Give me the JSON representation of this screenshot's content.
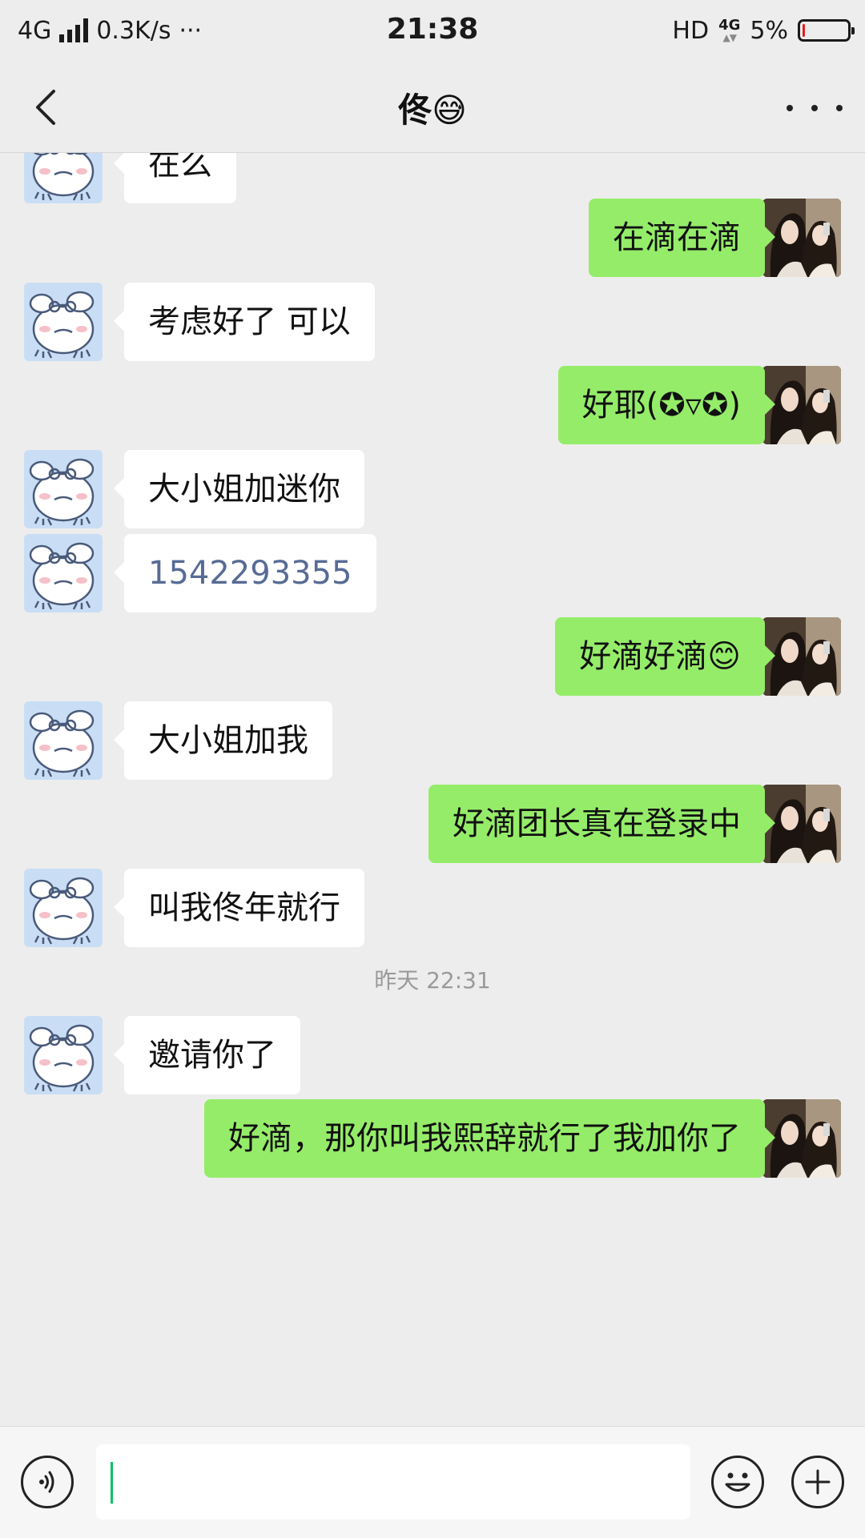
{
  "status_bar": {
    "network": "4G",
    "speed": "0.3K/s",
    "more": "···",
    "time": "21:38",
    "hd": "HD",
    "net_type": "4G",
    "battery_percent": "5%",
    "battery_level": 0.05
  },
  "nav": {
    "title": "佟😅"
  },
  "messages": [
    {
      "side": "in",
      "text": "在么"
    },
    {
      "side": "out",
      "text": "在滴在滴"
    },
    {
      "side": "in",
      "text": "考虑好了 可以"
    },
    {
      "side": "out",
      "text": "好耶(✪▿✪)"
    },
    {
      "side": "in",
      "text": "大小姐加迷你"
    },
    {
      "side": "in",
      "text": "1542293355"
    },
    {
      "side": "out",
      "text": "好滴好滴😊"
    },
    {
      "side": "in",
      "text": "大小姐加我"
    },
    {
      "side": "out",
      "text": "好滴团长真在登录中"
    },
    {
      "side": "in",
      "text": "叫我佟年就行"
    },
    {
      "side": "in",
      "text": "邀请你了"
    },
    {
      "side": "out",
      "text": "好滴，那你叫我熙辞就行了我加你了"
    }
  ],
  "timestamp": "昨天 22:31",
  "icons": {
    "back": "chevron-left-icon",
    "more": "more-dots-icon",
    "voice": "voice-icon",
    "emoji": "emoji-icon",
    "plus": "plus-icon"
  },
  "colors": {
    "background": "#ededed",
    "incoming_bubble": "#ffffff",
    "outgoing_bubble": "#95ec69",
    "link": "#576b95",
    "caret": "#07c160"
  }
}
